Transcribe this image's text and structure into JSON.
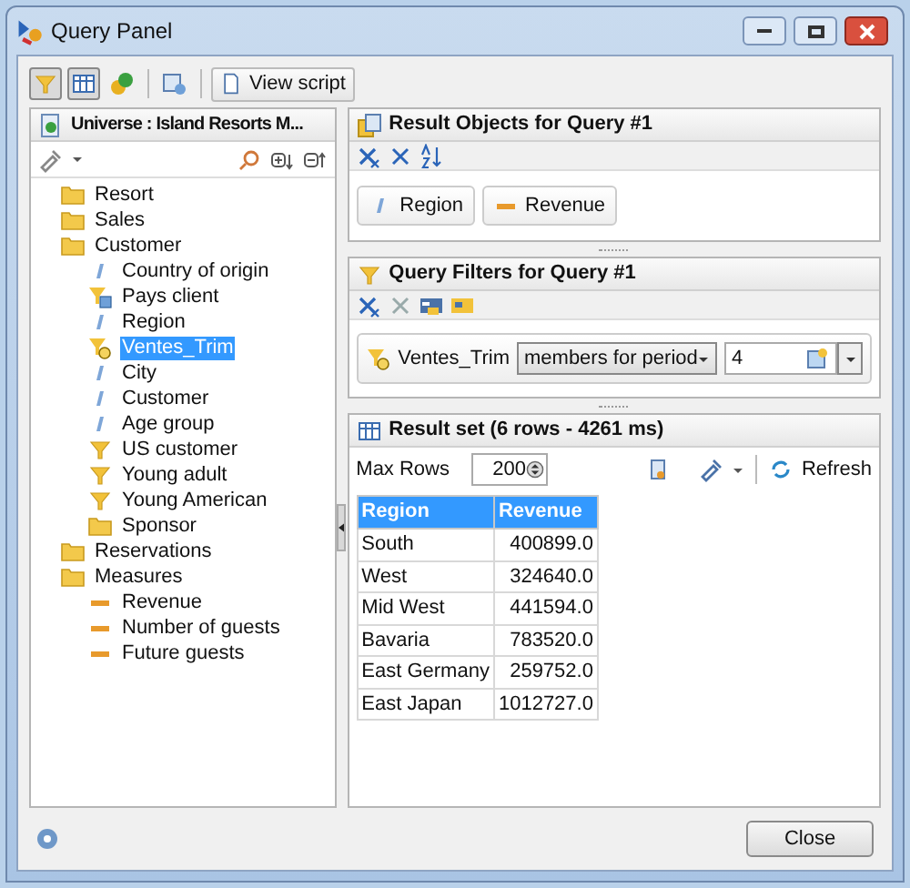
{
  "window": {
    "title": "Query Panel"
  },
  "toolbar": {
    "toggles": [
      {
        "selected": true
      },
      {
        "selected": true
      }
    ],
    "view_script": "View script"
  },
  "universe": {
    "title": "Universe : Island Resorts M...",
    "tree": [
      {
        "label": "Resort",
        "kind": "folder",
        "selected": false
      },
      {
        "label": "Sales",
        "kind": "folder",
        "selected": false
      },
      {
        "label": "Customer",
        "kind": "folder",
        "selected": false,
        "children": [
          {
            "label": "Country of origin",
            "kind": "dimension",
            "selected": false
          },
          {
            "label": "Pays client",
            "kind": "predefined",
            "selected": false
          },
          {
            "label": "Region",
            "kind": "dimension",
            "selected": false
          },
          {
            "label": "Ventes_Trim",
            "kind": "prompt",
            "selected": true
          },
          {
            "label": "City",
            "kind": "dimension",
            "selected": false
          },
          {
            "label": "Customer",
            "kind": "dimension",
            "selected": false
          },
          {
            "label": "Age group",
            "kind": "dimension",
            "selected": false
          },
          {
            "label": "US customer",
            "kind": "filter",
            "selected": false
          },
          {
            "label": "Young adult",
            "kind": "filter",
            "selected": false
          },
          {
            "label": "Young American",
            "kind": "filter",
            "selected": false
          },
          {
            "label": "Sponsor",
            "kind": "folder",
            "selected": false
          }
        ]
      },
      {
        "label": "Reservations",
        "kind": "folder",
        "selected": false
      },
      {
        "label": "Measures",
        "kind": "folder",
        "selected": false,
        "children": [
          {
            "label": "Revenue",
            "kind": "measure",
            "selected": false
          },
          {
            "label": "Number of guests",
            "kind": "measure",
            "selected": false
          },
          {
            "label": "Future guests",
            "kind": "measure",
            "selected": false
          }
        ]
      }
    ]
  },
  "result_objects": {
    "title": "Result Objects for Query #1",
    "items": [
      {
        "label": "Region",
        "kind": "dimension"
      },
      {
        "label": "Revenue",
        "kind": "measure"
      }
    ]
  },
  "query_filters": {
    "title": "Query Filters for Query #1",
    "filters": [
      {
        "object": "Ventes_Trim",
        "operator": "members for period",
        "value": "4"
      }
    ]
  },
  "result_set": {
    "title": "Result set (6 rows - 4261 ms)",
    "max_rows_label": "Max Rows",
    "max_rows": "200",
    "refresh": "Refresh",
    "columns": [
      "Region",
      "Revenue"
    ],
    "rows": [
      [
        "South",
        "400899.0"
      ],
      [
        "West",
        "324640.0"
      ],
      [
        "Mid West",
        "441594.0"
      ],
      [
        "Bavaria",
        "783520.0"
      ],
      [
        "East Germany",
        "259752.0"
      ],
      [
        "East Japan",
        "1012727.0"
      ]
    ]
  },
  "buttons": {
    "close": "Close"
  }
}
